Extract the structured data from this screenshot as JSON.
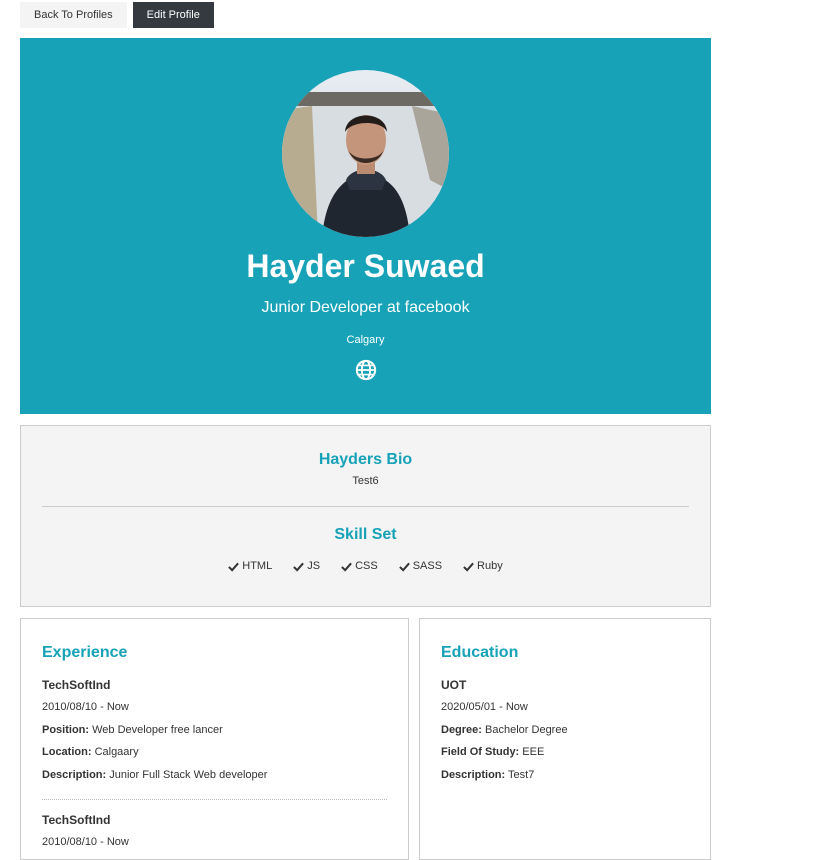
{
  "nav": {
    "back_label": "Back To Profiles",
    "edit_label": "Edit Profile"
  },
  "profile": {
    "name": "Hayder Suwaed",
    "headline": "Junior Developer at facebook",
    "location": "Calgary",
    "website_icon": "globe-icon"
  },
  "about": {
    "bio_title": "Hayders Bio",
    "bio": "Test6",
    "skills_title": "Skill Set",
    "skills": [
      "HTML",
      "JS",
      "CSS",
      "SASS",
      "Ruby"
    ]
  },
  "experience": {
    "title": "Experience",
    "items": [
      {
        "company": "TechSoftInd",
        "dates": "2010/08/10 - Now",
        "position_label": "Position:",
        "position": "Web Developer free lancer",
        "location_label": "Location:",
        "location": "Calgaary",
        "description_label": "Description:",
        "description": "Junior Full Stack Web developer"
      },
      {
        "company": "TechSoftInd",
        "dates": "2010/08/10 - Now"
      }
    ]
  },
  "education": {
    "title": "Education",
    "items": [
      {
        "school": "UOT",
        "dates": "2020/05/01 - Now",
        "degree_label": "Degree:",
        "degree": "Bachelor Degree",
        "field_label": "Field Of Study:",
        "field": "EEE",
        "description_label": "Description:",
        "description": "Test7"
      }
    ]
  },
  "colors": {
    "accent": "#17a2b8",
    "dark_button": "#343a40",
    "panel": "#f4f4f4"
  }
}
